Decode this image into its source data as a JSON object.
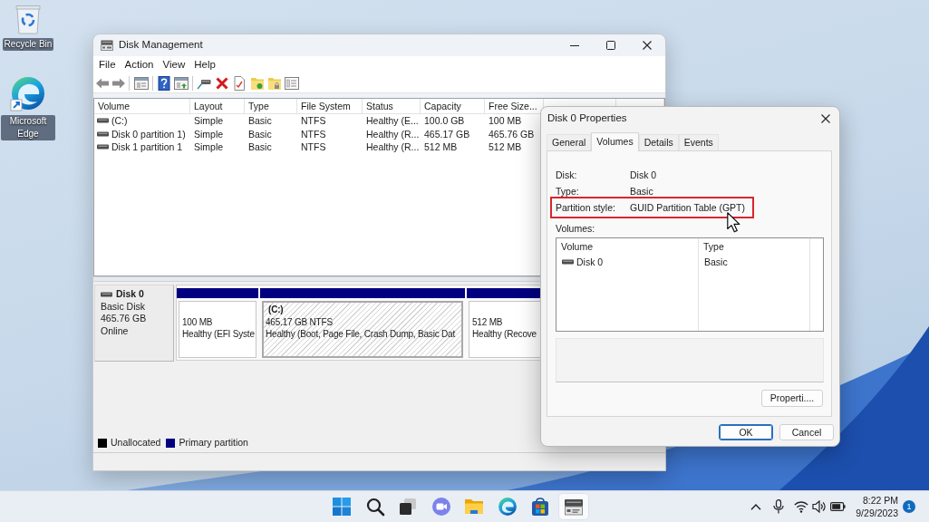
{
  "desktop_icons": [
    {
      "label": "Recycle Bin"
    },
    {
      "label": "Microsoft Edge"
    }
  ],
  "disk_management": {
    "title": "Disk Management",
    "menu": [
      "File",
      "Action",
      "View",
      "Help"
    ],
    "table": {
      "columns": [
        "Volume",
        "Layout",
        "Type",
        "File System",
        "Status",
        "Capacity",
        "Free Size..."
      ],
      "rows": [
        [
          "(C:)",
          "Simple",
          "Basic",
          "NTFS",
          "Healthy (E...",
          "100.0 GB",
          "100 MB"
        ],
        [
          "Disk 0 partition 1)",
          "Simple",
          "Basic",
          "NTFS",
          "Healthy (R...",
          "465.17 GB",
          "465.76 GB"
        ],
        [
          "Disk 1 partition 1",
          "Simple",
          "Basic",
          "NTFS",
          "Healthy (R...",
          "512 MB",
          "512 MB"
        ]
      ]
    },
    "disk": {
      "name": "Disk 0",
      "type": "Basic Disk",
      "size": "465.76 GB",
      "status": "Online",
      "partitions": [
        {
          "size": "100 MB",
          "status": "Healthy (EFI Syste",
          "color": "#000080",
          "selected": false
        },
        {
          "label": "(C:)",
          "size": "465.17 GB NTFS",
          "status": "Healthy (Boot, Page File, Crash Dump, Basic Dat",
          "color": "#000080",
          "selected": true
        },
        {
          "size": "512 MB",
          "status": "Healthy (Recove",
          "color": "#000080",
          "selected": false
        }
      ]
    },
    "legend": [
      {
        "label": "Unallocated",
        "color": "#000000"
      },
      {
        "label": "Primary partition",
        "color": "#000080"
      }
    ]
  },
  "properties_dialog": {
    "title": "Disk 0 Properties",
    "tabs": [
      {
        "label": "General",
        "selected": false
      },
      {
        "label": "Volumes",
        "selected": true
      },
      {
        "label": "Details",
        "selected": false
      },
      {
        "label": "Events",
        "selected": false
      }
    ],
    "fields": [
      {
        "label": "Disk:",
        "value": "Disk 0",
        "highlighted": false
      },
      {
        "label": "Type:",
        "value": "Basic",
        "highlighted": false
      },
      {
        "label": "Partition style:",
        "value": "GUID Partition Table (GPT)",
        "highlighted": true
      }
    ],
    "volumes_label": "Volumes:",
    "volumes": {
      "columns": [
        "Volume",
        "Type"
      ],
      "rows": [
        [
          "Disk 0",
          "Basic"
        ]
      ]
    },
    "properties_button": "Properti....",
    "buttons": [
      {
        "label": "OK",
        "default": true
      },
      {
        "label": "Cancel",
        "default": false
      }
    ]
  },
  "taskbar": {
    "apps": [
      {
        "selected": false
      },
      {
        "selected": false
      },
      {
        "selected": false
      },
      {
        "selected": false
      },
      {
        "selected": false
      },
      {
        "selected": false
      },
      {
        "selected": false
      },
      {
        "selected": true
      }
    ],
    "time": "8:22 PM",
    "date": "9/29/2023",
    "notification_count": "1"
  }
}
